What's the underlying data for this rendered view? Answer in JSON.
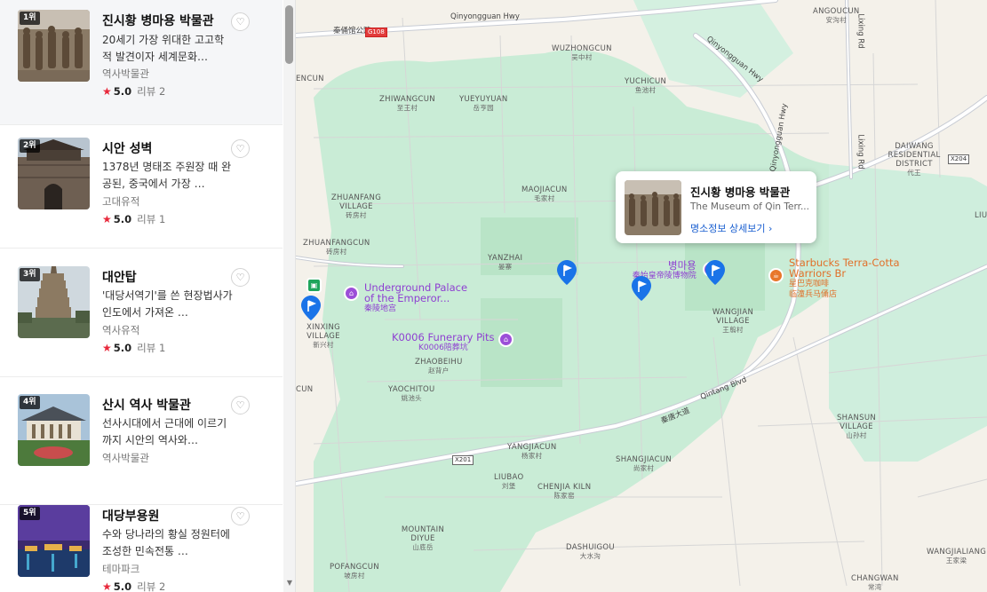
{
  "sidebar": {
    "places": [
      {
        "rank": "1위",
        "name": "진시황 병마용 박물관",
        "desc": "20세기 가장 위대한 고고학적 발견이자 세계문화…",
        "category": "역사박물관",
        "rating": "5.0",
        "reviews": "리뷰 2",
        "star": "★"
      },
      {
        "rank": "2위",
        "name": "시안 성벽",
        "desc": "1378년 명태조 주원장 때 완공된, 중국에서 가장 …",
        "category": "고대유적",
        "rating": "5.0",
        "reviews": "리뷰 1",
        "star": "★"
      },
      {
        "rank": "3위",
        "name": "대안탑",
        "desc": "'대당서역기'를 쓴 현장법사가 인도에서 가져온 …",
        "category": "역사유적",
        "rating": "5.0",
        "reviews": "리뷰 1",
        "star": "★"
      },
      {
        "rank": "4위",
        "name": "산시 역사 박물관",
        "desc": "선사시대에서 근대에 이르기까지 시안의 역사와…",
        "category": "역사박물관"
      },
      {
        "rank": "5위",
        "name": "대당부용원",
        "desc": "수와 당나라의 황실 정원터에 조성한 민속전통 …",
        "category": "테마파크",
        "rating": "5.0",
        "reviews": "리뷰 2",
        "star": "★"
      }
    ],
    "heart_glyph": "♡",
    "scroll_down_glyph": "▼"
  },
  "map": {
    "colors": {
      "land": "#f4f1ea",
      "green": "#c9ecd6",
      "road": "#ffffff",
      "road_edge": "#c8ccd4",
      "purple": "#9c4fd8",
      "orange": "#e8772a",
      "pin": "#1a73e8"
    },
    "places": [
      {
        "en": "ANGOUCUN",
        "zh": "安沟村"
      },
      {
        "en": "WUZHONGCUN",
        "zh": "吴中村"
      },
      {
        "en": "YUCHICUN",
        "zh": "鱼池村"
      },
      {
        "en": "ZHIWANGCUN",
        "zh": "至王村"
      },
      {
        "en": "YUEYUYUAN",
        "zh": "岳亨园"
      },
      {
        "en": "DAIWANG RESIDENTIAL DISTRICT",
        "zh": "代王"
      },
      {
        "en": "ZHUANFANG VILLAGE",
        "zh": "砖房村"
      },
      {
        "en": "MAOJIACUN",
        "zh": "毛家村"
      },
      {
        "en": "ZHUANFANGCUN",
        "zh": "砖房村"
      },
      {
        "en": "YANZHAI",
        "zh": "晏寨"
      },
      {
        "en": "XINXING VILLAGE",
        "zh": "新兴村"
      },
      {
        "en": "ZHAOBEIHU",
        "zh": "赵背户"
      },
      {
        "en": "WANGJIAN VILLAGE",
        "zh": "王翦村"
      },
      {
        "en": "YAOCHITOU",
        "zh": "姚池头"
      },
      {
        "en": "SHANSUN VILLAGE",
        "zh": "山孙村"
      },
      {
        "en": "YANGJIACUN",
        "zh": "杨家村"
      },
      {
        "en": "SHANGJIACUN",
        "zh": "尚家村"
      },
      {
        "en": "LIUBAO",
        "zh": "刘堡"
      },
      {
        "en": "CHENJIA KILN",
        "zh": "陈家窑"
      },
      {
        "en": "MOUNTAIN DIYUE",
        "zh": "山底岳"
      },
      {
        "en": "DASHUIGOU",
        "zh": "大水沟"
      },
      {
        "en": "POFANGCUN",
        "zh": "坡房村"
      },
      {
        "en": "CHANGWAN",
        "zh": "常湾"
      },
      {
        "en": "WANGJIALIANG",
        "zh": "王家梁"
      },
      {
        "en": "ENCUN",
        "zh": ""
      },
      {
        "en": "CUN",
        "zh": ""
      },
      {
        "en": "LIU",
        "zh": ""
      }
    ],
    "roads": {
      "qinyong_top": "Qinyongguan Hwy",
      "qinyong_diag": "Qinyongguan Hwy",
      "lixing_left": "Lixing Rd",
      "lixing_right": "Lixing Rd",
      "qintang": "Qintang Blvd",
      "qintang_zh": "秦唐大道",
      "bingmayong_zh": "秦俑馆公路",
      "g108": "G108",
      "x204": "X204",
      "x201": "X201"
    },
    "pois": {
      "underground": {
        "line1": "Underground Palace",
        "line2": "of the Emperor...",
        "zh": "秦陵地宫"
      },
      "k0006": {
        "line1": "K0006 Funerary Pits",
        "zh": "K0006陪葬坑"
      },
      "museum": {
        "line1": "병마용",
        "zh": "秦始皇帝陵博物院"
      },
      "starbucks": {
        "line1": "Starbucks Terra-Cotta",
        "line2": "Warriors Br",
        "zh1": "星巴克咖啡",
        "zh2": "临潼兵马俑店"
      },
      "icon_museum": "museum-icon",
      "icon_cafe": "coffee-icon",
      "icon_transit": "transit-icon"
    },
    "popup": {
      "title": "진시황 병마용 박물관",
      "subtitle": "The Museum of Qin Terr...",
      "link": "명소정보 상세보기 ›"
    }
  }
}
